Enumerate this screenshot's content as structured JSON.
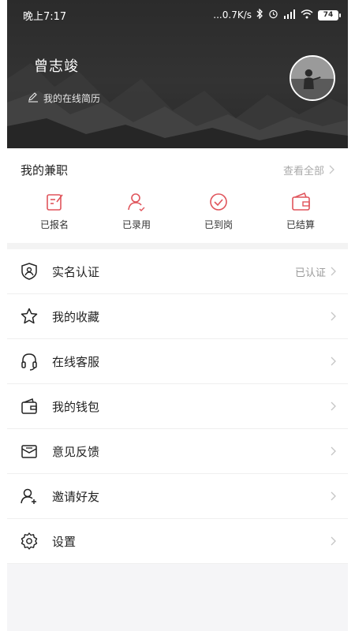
{
  "status_bar": {
    "time": "晚上7:17",
    "network_speed": "...0.7K/s",
    "battery": "74"
  },
  "profile": {
    "name": "曾志竣",
    "resume_link": "我的在线简历"
  },
  "jobs": {
    "title": "我的兼职",
    "view_all": "查看全部",
    "items": [
      {
        "label": "已报名",
        "icon": "signup-icon"
      },
      {
        "label": "已录用",
        "icon": "hired-icon"
      },
      {
        "label": "已到岗",
        "icon": "on-duty-icon"
      },
      {
        "label": "已结算",
        "icon": "wallet-settled-icon"
      }
    ]
  },
  "menu": [
    {
      "label": "实名认证",
      "value": "已认证",
      "icon": "shield-verify-icon"
    },
    {
      "label": "我的收藏",
      "value": "",
      "icon": "star-icon"
    },
    {
      "label": "在线客服",
      "value": "",
      "icon": "headset-icon"
    },
    {
      "label": "我的钱包",
      "value": "",
      "icon": "wallet-icon"
    },
    {
      "label": "意见反馈",
      "value": "",
      "icon": "feedback-mail-icon"
    },
    {
      "label": "邀请好友",
      "value": "",
      "icon": "invite-user-icon"
    },
    {
      "label": "设置",
      "value": "",
      "icon": "settings-gear-icon"
    }
  ],
  "colors": {
    "accent": "#e0545b",
    "header_bg": "#2e2e2e"
  }
}
